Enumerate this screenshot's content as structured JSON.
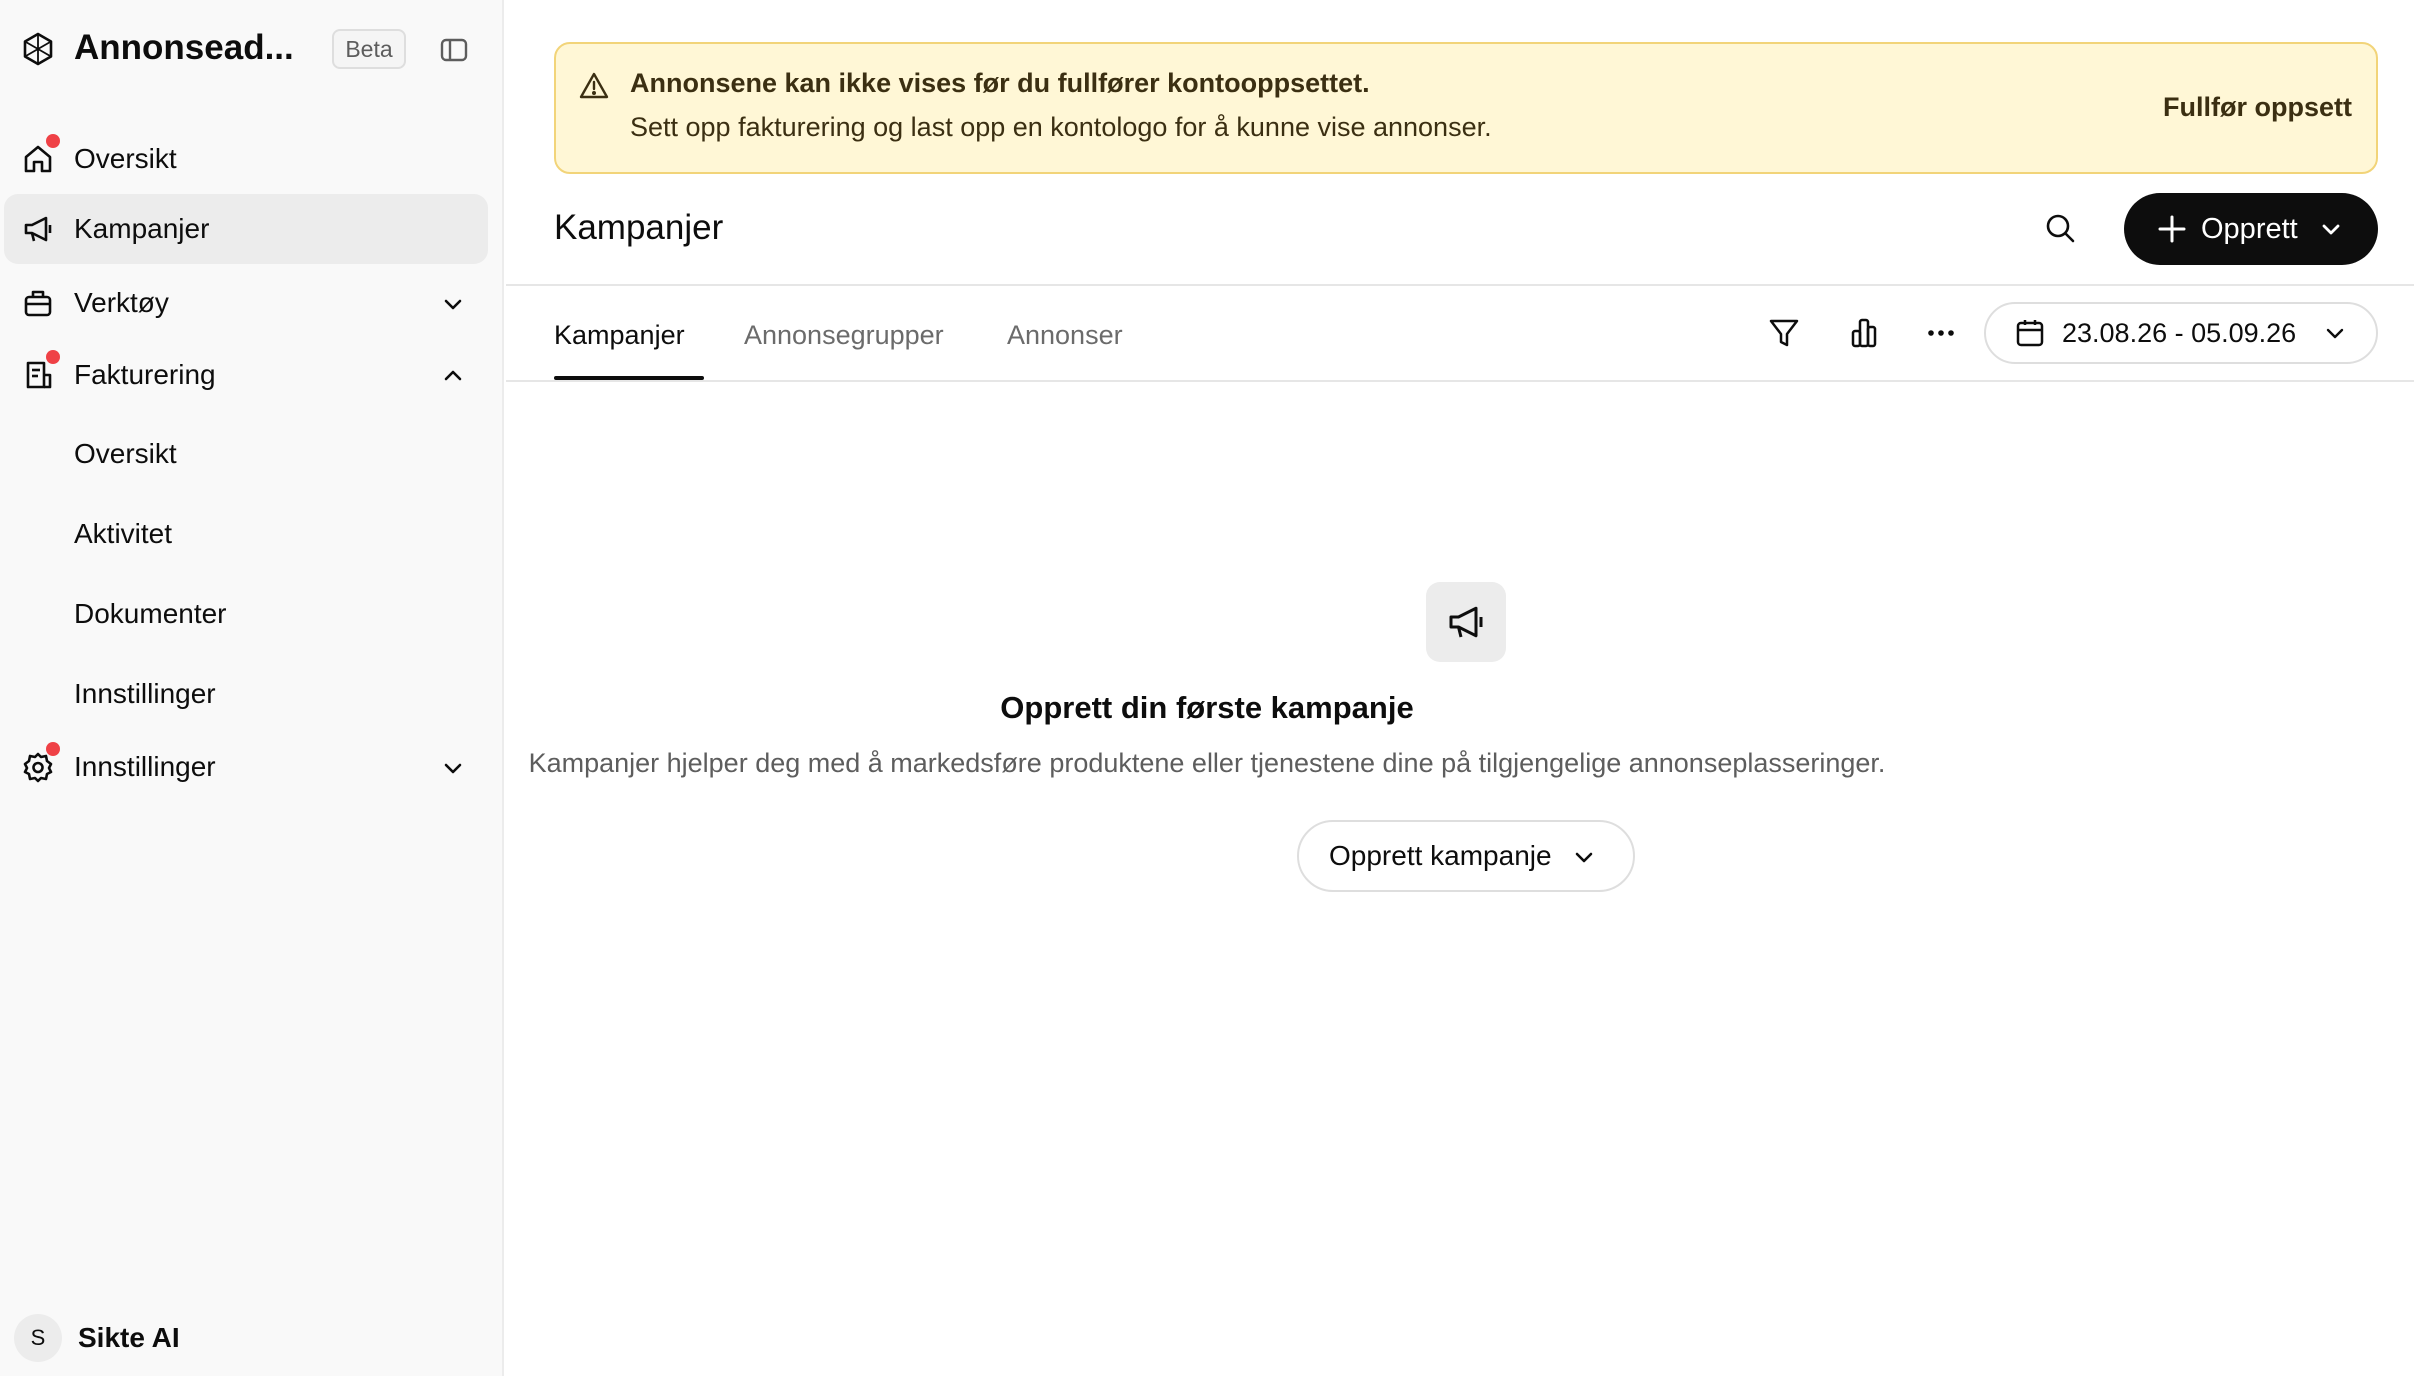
{
  "app": {
    "brand_title": "Annonsead...",
    "beta_badge": "Beta",
    "accent_color": "#0d0d0d",
    "notification_dot_color": "#ef4146"
  },
  "sidebar": {
    "items": [
      {
        "label": "Oversikt",
        "icon": "home-icon",
        "notification": true
      },
      {
        "label": "Kampanjer",
        "icon": "megaphone-icon",
        "active": true
      },
      {
        "label": "Verktøy",
        "icon": "toolbox-icon",
        "expanded": false
      },
      {
        "label": "Fakturering",
        "icon": "billing-icon",
        "notification": true,
        "expanded": true
      },
      {
        "label": "Innstillinger",
        "icon": "gear-icon",
        "notification": true,
        "expanded": false
      }
    ],
    "billing_subitems": [
      "Oversikt",
      "Aktivitet",
      "Dokumenter",
      "Innstillinger"
    ],
    "user": {
      "initial": "S",
      "name": "Sikte AI"
    }
  },
  "banner": {
    "title": "Annonsene kan ikke vises før du fullfører kontooppsettet.",
    "text": "Sett opp fakturering og last opp en kontologo for å kunne vise annonser.",
    "action": "Fullfør oppsett",
    "background_color": "#fff7d6"
  },
  "header": {
    "title": "Kampanjer",
    "create_label": "Opprett"
  },
  "tabs": [
    "Kampanjer",
    "Annonsegrupper",
    "Annonser"
  ],
  "active_tab": "Kampanjer",
  "toolbar": {
    "icons": [
      "filter-icon",
      "chart-icon",
      "more-icon"
    ],
    "date_range": "23.08.26 - 05.09.26"
  },
  "empty_state": {
    "icon": "megaphone-icon",
    "title": "Opprett din første kampanje",
    "description": "Kampanjer hjelper deg med å markedsføre produktene eller tjenestene dine på tilgjengelige annonseplasseringer.",
    "button": "Opprett kampanje"
  }
}
